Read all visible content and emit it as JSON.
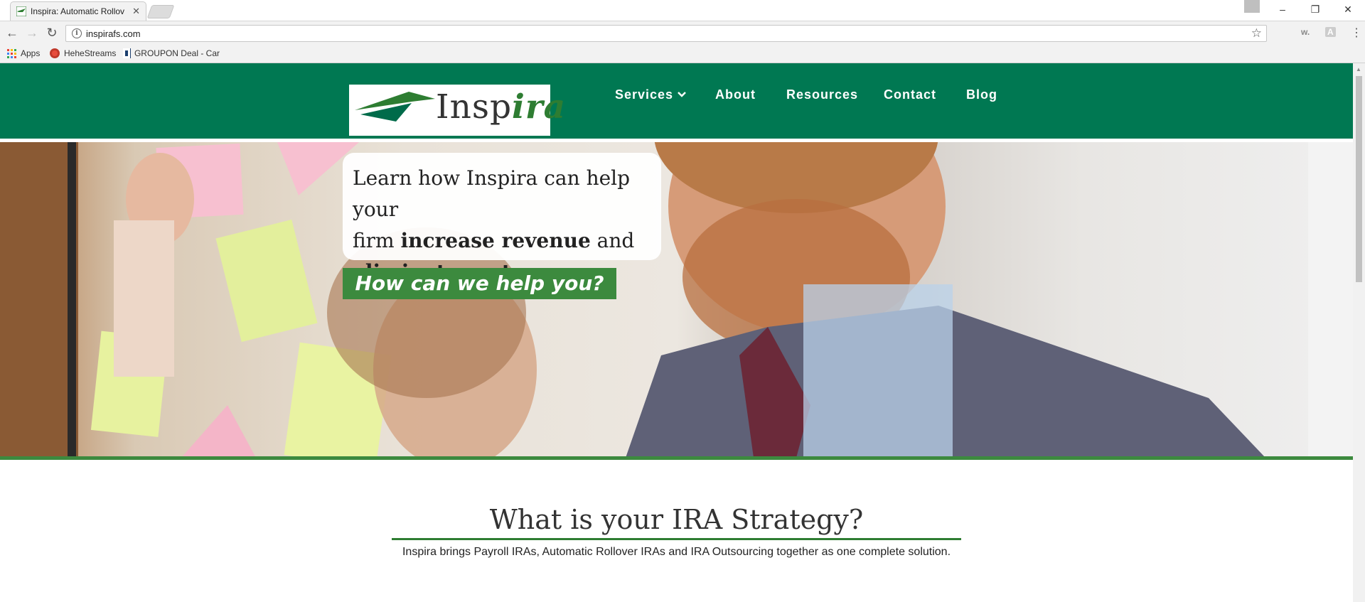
{
  "browser": {
    "tab_title": "Inspira: Automatic Rollov",
    "url": "inspirafs.com",
    "bookmarks": [
      "Apps",
      "HeheStreams",
      "GROUPON Deal - Car"
    ],
    "extensions": [
      "w.",
      "A"
    ]
  },
  "site": {
    "logo_text": "Insp",
    "logo_accent": "ira",
    "nav": [
      "Services",
      "About",
      "Resources",
      "Contact",
      "Blog"
    ],
    "hero": {
      "line1": "Learn how Inspira can help your",
      "line2_pre": "firm ",
      "line2_bold": "increase revenue",
      "line2_post": " and",
      "line3_bold": "eliminate costs",
      "line3_post": ".",
      "cta": "How can we help you?"
    },
    "section": {
      "title": "What is your IRA Strategy?",
      "subtitle": "Inspira brings Payroll IRAs, Automatic Rollover IRAs and IRA Outsourcing together as one complete solution."
    }
  },
  "colors": {
    "brand_green": "#007852",
    "accent_green": "#3c8a3e"
  }
}
